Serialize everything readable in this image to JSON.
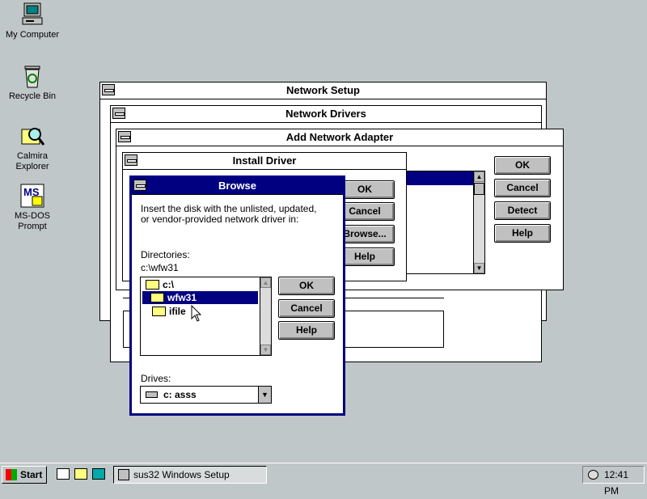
{
  "desktop": {
    "icons": [
      {
        "label_lines": [
          "My Computer"
        ]
      },
      {
        "label_lines": [
          "Recycle Bin"
        ]
      },
      {
        "label_lines": [
          "Calmira",
          "Explorer"
        ]
      },
      {
        "label_lines": [
          "MS-DOS",
          "Prompt"
        ]
      }
    ],
    "msdos_glyph": "MS"
  },
  "network_setup": {
    "title": "Network Setup"
  },
  "network_drivers": {
    "title": "Network Drivers"
  },
  "add_adapter": {
    "title": "Add Network Adapter",
    "ok": "OK",
    "cancel": "Cancel",
    "detect": "Detect",
    "help": "Help"
  },
  "install_driver": {
    "title": "Install Driver",
    "ok": "OK",
    "cancel": "Cancel",
    "browse": "Browse...",
    "help": "Help"
  },
  "browse": {
    "title": "Browse",
    "instruction_line1": "Insert the disk with the unlisted, updated,",
    "instruction_line2": "or vendor-provided network driver in:",
    "directories_label": "Directories:",
    "current_path": "c:\\wfw31",
    "tree": [
      {
        "name": "c:\\",
        "selected": false
      },
      {
        "name": "wfw31",
        "selected": true
      },
      {
        "name": "ifile",
        "selected": false
      }
    ],
    "drives_label": "Drives:",
    "drive_value": "c: asss",
    "ok": "OK",
    "cancel": "Cancel",
    "help": "Help"
  },
  "taskbar": {
    "start_label": "Start",
    "task_label": "sus32 Windows Setup",
    "clock": "12:41 PM"
  },
  "colors": {
    "desktop": "#c0c7c8",
    "titlebar_active": "#000080",
    "selection": "#000080"
  }
}
